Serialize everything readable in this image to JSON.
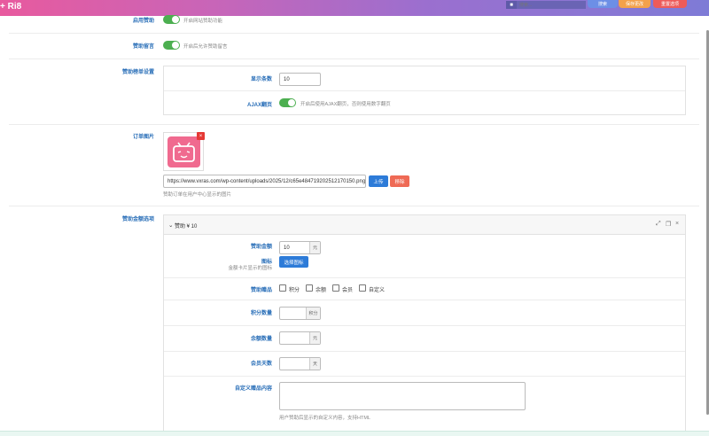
{
  "topbar": {
    "brand": "+ Ri8",
    "search_placeholder": "搜索...",
    "btn_search": "搜索",
    "btn_save": "保存更改",
    "btn_reset": "重置选项"
  },
  "settings": {
    "enable_donate": {
      "label": "启用赞助",
      "desc": "开启网站赞助功能"
    },
    "donate_comment": {
      "label": "赞助留言",
      "desc": "开启后允许赞助留言"
    },
    "donate_list": {
      "label": "赞助榜单设置",
      "count_label": "显示条数",
      "count_value": "10",
      "ajax_label": "AJAX翻页",
      "ajax_desc": "开启后使用AJAX翻页，否则使用数字翻页"
    },
    "order_image": {
      "label": "订单图片",
      "url": "https://www.vxras.com/wp-content/uploads/2025/12/c65e484719202512170150.png",
      "upload": "上传",
      "remove": "移除",
      "desc": "赞助订单在用户中心显示的图片"
    },
    "amount_options": {
      "label": "赞助金额选项",
      "item_header": "赞助 ¥ 10",
      "amount_label": "赞助金额",
      "amount_value": "10",
      "amount_unit": "元",
      "icon_label": "图标",
      "icon_desc": "金额卡片显示的图标",
      "icon_btn": "选择图标",
      "gift_label": "赞助赠品",
      "gifts": [
        "积分",
        "余额",
        "会员",
        "自定义"
      ],
      "points_label": "积分数量",
      "points_unit": "积分",
      "balance_label": "余额数量",
      "balance_unit": "元",
      "vip_label": "会员天数",
      "vip_unit": "天",
      "custom_label": "自定义赠品内容",
      "custom_desc": "用户赞助后显示的自定义内容，支持HTML"
    }
  },
  "colors": {
    "toggle_on": "#4caf50",
    "label_blue": "#2a6fb8",
    "primary_btn": "#2d7bd8",
    "danger_btn": "#ef6a55"
  }
}
